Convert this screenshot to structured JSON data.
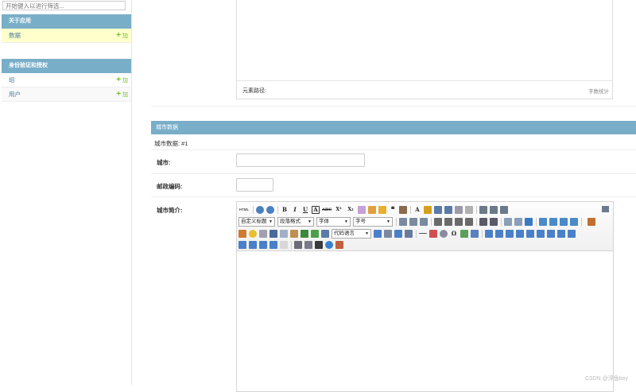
{
  "sidebar": {
    "filter_placeholder": "开始键入以进行筛选...",
    "modules": [
      {
        "caption": "关于应用",
        "rows": [
          {
            "label": "数据",
            "add": "加"
          }
        ]
      },
      {
        "caption": "身份验证和授权",
        "rows": [
          {
            "label": "组",
            "add": "加"
          },
          {
            "label": "用户",
            "add": "加"
          }
        ]
      }
    ]
  },
  "upper_editor": {
    "path_label": "元素路径:",
    "wordcount_label": "字数统计"
  },
  "inline": {
    "caption": "城市数据",
    "subheading": "城市数据:  #1",
    "fields": {
      "city_label": "城市:",
      "zip_label": "邮政编码:",
      "intro_label": "城市简介:"
    }
  },
  "ueditor": {
    "dropdowns": {
      "custom_title": "自定义标题",
      "paragraph": "段落格式",
      "font": "字体",
      "font_size": "字号",
      "code_lang": "代码语言"
    },
    "icons": {
      "html": "HTML",
      "bold": "B",
      "italic": "I",
      "underline": "U",
      "strike": "ABC",
      "superscript": "X²",
      "subscript": "X₂",
      "font_color": "A",
      "quote": "❝",
      "omega": "Ω"
    }
  },
  "colors": {
    "accent": "#79aec8",
    "link": "#447e9b",
    "add": "#70bf2b",
    "active_row": "#ffffcc"
  },
  "watermark": "CSDN @浮鱼boy"
}
